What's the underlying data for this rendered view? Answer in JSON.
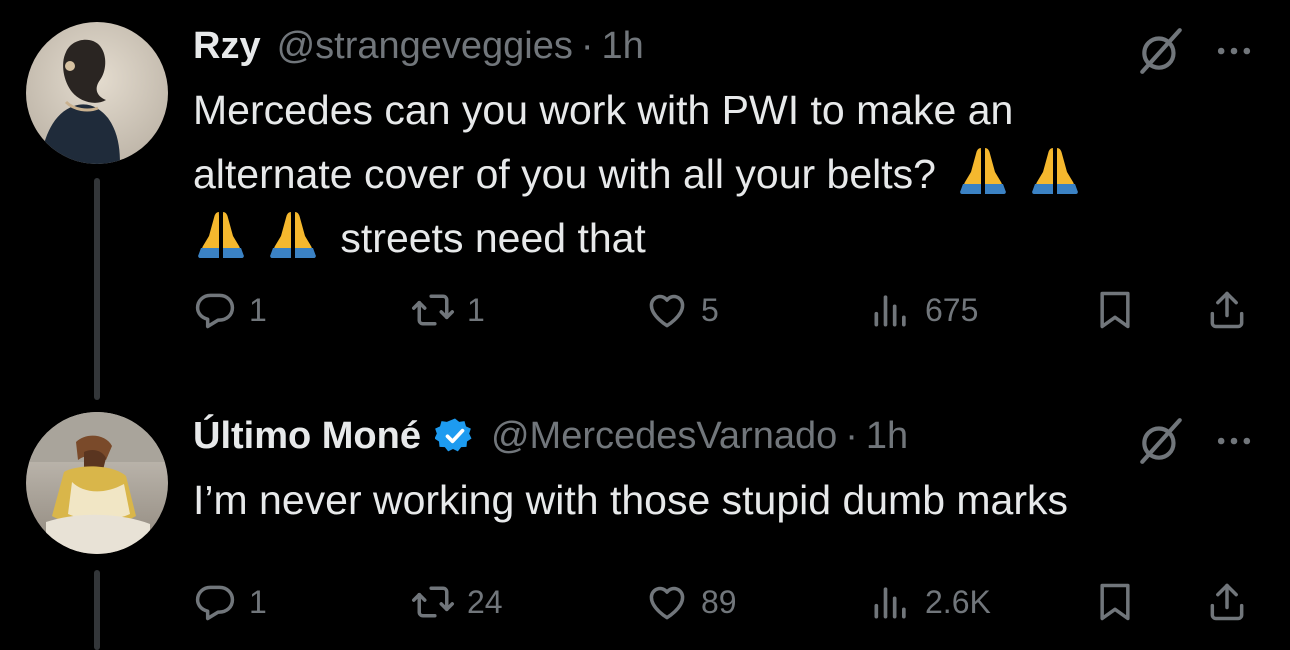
{
  "tweets": [
    {
      "name": "Rzy",
      "handle": "@strangeveggies",
      "separator": "·",
      "time": "1h",
      "verified": false,
      "text_line1": "Mercedes can you work with PWI to make an",
      "text_line2_prefix": "alternate cover of you with all your belts?",
      "text_line3_suffix": "streets need that",
      "emoji_name": "folded-hands",
      "stats": {
        "replies": "1",
        "reposts": "1",
        "likes": "5",
        "views": "675"
      }
    },
    {
      "name": "Último Moné",
      "handle": "@MercedesVarnado",
      "separator": "·",
      "time": "1h",
      "verified": true,
      "text_line1": "I’m never working with those stupid dumb marks",
      "stats": {
        "replies": "1",
        "reposts": "24",
        "likes": "89",
        "views": "2.6K"
      }
    }
  ],
  "colors": {
    "background": "#000000",
    "text": "#e7e9ea",
    "muted": "#71767b",
    "verified": "#1d9bf0",
    "thread_line": "#333639"
  },
  "icons": [
    "reply-icon",
    "retweet-icon",
    "like-icon",
    "views-icon",
    "bookmark-icon",
    "share-icon",
    "grok-icon",
    "more-icon",
    "verified-badge-icon"
  ]
}
